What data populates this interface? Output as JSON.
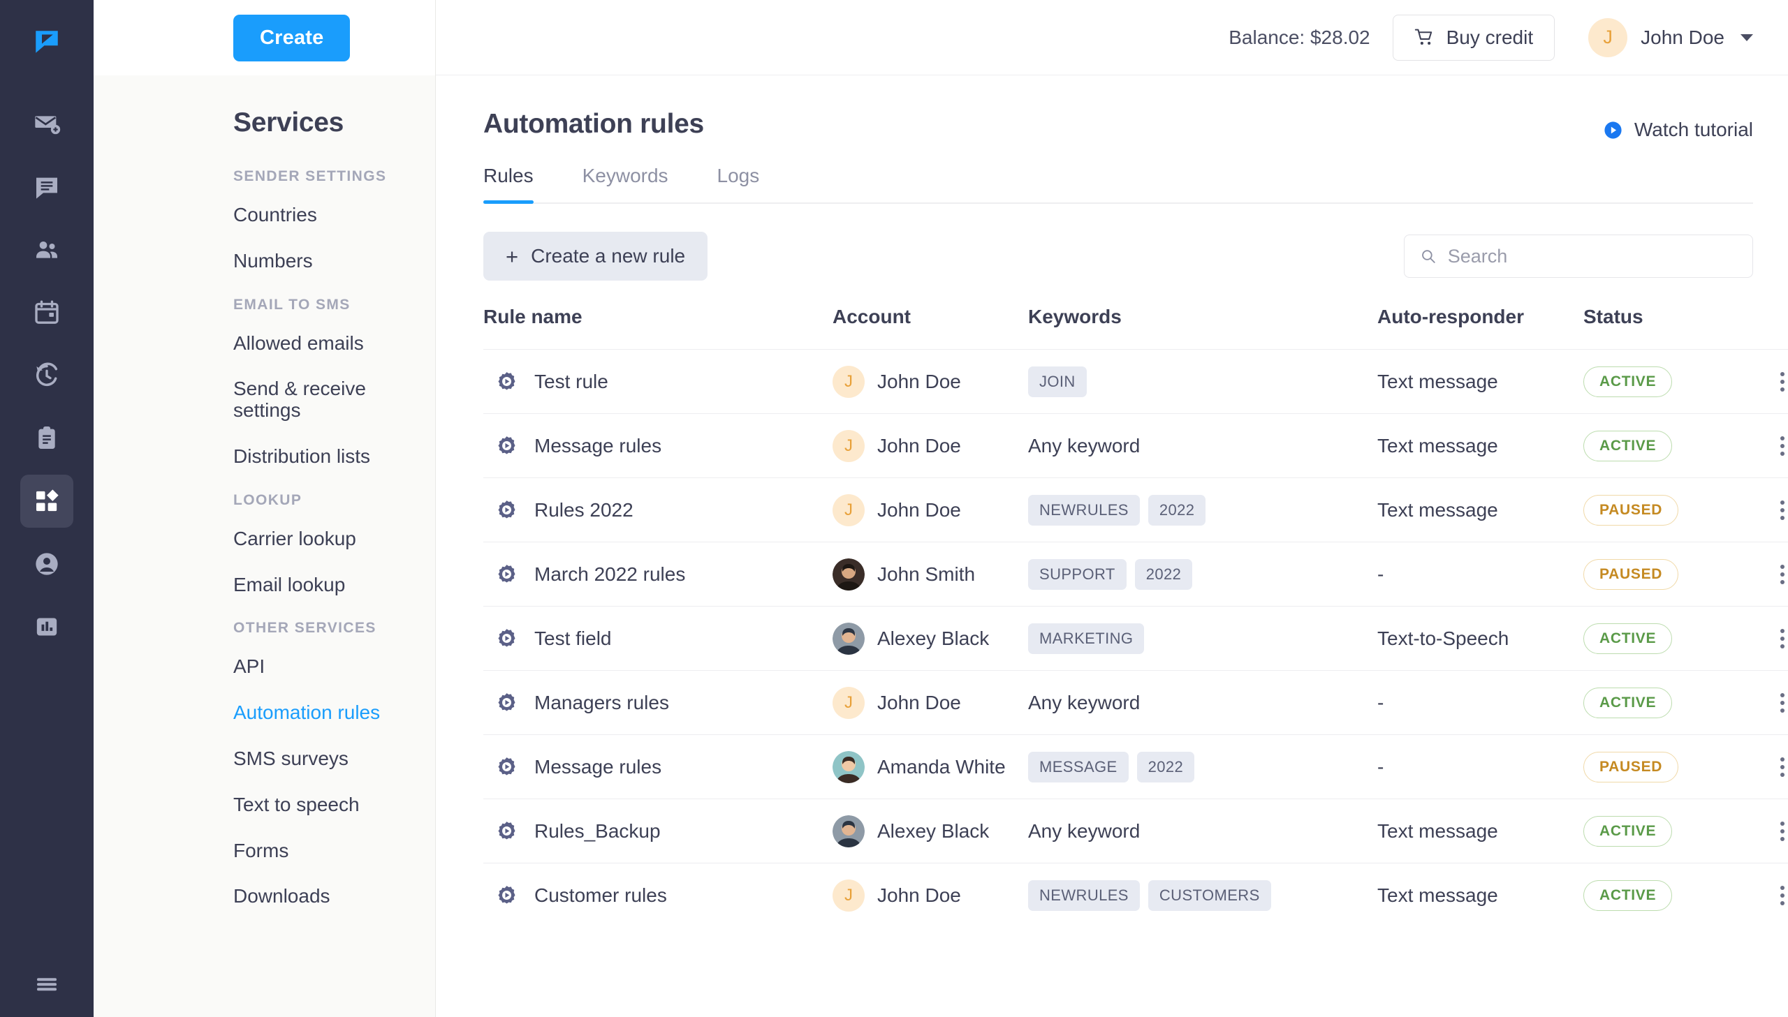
{
  "rail": {
    "items": [
      {
        "icon": "chat-logo-icon",
        "name": "logo",
        "active": false
      },
      {
        "icon": "mail-add-icon",
        "name": "compose",
        "active": false
      },
      {
        "icon": "chat-bubble-icon",
        "name": "messages",
        "active": false
      },
      {
        "icon": "contacts-icon",
        "name": "contacts",
        "active": false
      },
      {
        "icon": "calendar-icon",
        "name": "calendar",
        "active": false
      },
      {
        "icon": "history-icon",
        "name": "history",
        "active": false
      },
      {
        "icon": "clipboard-icon",
        "name": "templates",
        "active": false
      },
      {
        "icon": "apps-grid-icon",
        "name": "services",
        "active": true
      },
      {
        "icon": "account-circle-icon",
        "name": "account",
        "active": false
      },
      {
        "icon": "bar-chart-icon",
        "name": "statistics",
        "active": false
      }
    ],
    "bottom": {
      "icon": "hamburger-icon",
      "name": "collapse-menu"
    }
  },
  "sidebar": {
    "create_label": "Create",
    "title": "Services",
    "groups": [
      {
        "label": "SENDER SETTINGS",
        "items": [
          {
            "label": "Countries",
            "active": false
          },
          {
            "label": "Numbers",
            "active": false
          }
        ]
      },
      {
        "label": "EMAIL TO SMS",
        "items": [
          {
            "label": "Allowed emails",
            "active": false
          },
          {
            "label": "Send & receive settings",
            "active": false
          },
          {
            "label": "Distribution lists",
            "active": false
          }
        ]
      },
      {
        "label": "LOOKUP",
        "items": [
          {
            "label": "Carrier lookup",
            "active": false
          },
          {
            "label": "Email lookup",
            "active": false
          }
        ]
      },
      {
        "label": "OTHER SERVICES",
        "items": [
          {
            "label": "API",
            "active": false
          },
          {
            "label": "Automation rules",
            "active": true
          },
          {
            "label": "SMS surveys",
            "active": false
          },
          {
            "label": "Text to speech",
            "active": false
          },
          {
            "label": "Forms",
            "active": false
          },
          {
            "label": "Downloads",
            "active": false
          }
        ]
      }
    ]
  },
  "topbar": {
    "balance_label": "Balance: $28.02",
    "buy_credit_label": "Buy credit",
    "user_initial": "J",
    "user_name": "John Doe"
  },
  "page": {
    "title": "Automation rules",
    "watch_tutorial_label": "Watch tutorial"
  },
  "tabs": [
    {
      "label": "Rules",
      "active": true
    },
    {
      "label": "Keywords",
      "active": false
    },
    {
      "label": "Logs",
      "active": false
    }
  ],
  "toolbar": {
    "create_rule_label": "Create a new rule",
    "create_rule_plus": "+",
    "search_placeholder": "Search",
    "search_value": ""
  },
  "table": {
    "columns": [
      "Rule name",
      "Account",
      "Keywords",
      "Auto-responder",
      "Status",
      ""
    ],
    "rows": [
      {
        "rule_name": "Test rule",
        "account": "John Doe",
        "avatar_type": "initial",
        "avatar_initial": "J",
        "keywords": [
          "JOIN"
        ],
        "keywords_text": "",
        "auto_responder": "Text message",
        "status": "ACTIVE"
      },
      {
        "rule_name": "Message rules",
        "account": "John Doe",
        "avatar_type": "initial",
        "avatar_initial": "J",
        "keywords": [],
        "keywords_text": "Any keyword",
        "auto_responder": "Text message",
        "status": "ACTIVE"
      },
      {
        "rule_name": "Rules 2022",
        "account": "John Doe",
        "avatar_type": "initial",
        "avatar_initial": "J",
        "keywords": [
          "NEWRULES",
          "2022"
        ],
        "keywords_text": "",
        "auto_responder": "Text message",
        "status": "PAUSED"
      },
      {
        "rule_name": "March 2022 rules",
        "account": "John Smith",
        "avatar_type": "photo-dark",
        "avatar_initial": "",
        "keywords": [
          "SUPPORT",
          "2022"
        ],
        "keywords_text": "",
        "auto_responder": "-",
        "status": "PAUSED"
      },
      {
        "rule_name": "Test field",
        "account": "Alexey Black",
        "avatar_type": "photo-suit",
        "avatar_initial": "",
        "keywords": [
          "MARKETING"
        ],
        "keywords_text": "",
        "auto_responder": "Text-to-Speech",
        "status": "ACTIVE"
      },
      {
        "rule_name": "Managers rules",
        "account": "John Doe",
        "avatar_type": "initial",
        "avatar_initial": "J",
        "keywords": [],
        "keywords_text": "Any keyword",
        "auto_responder": "-",
        "status": "ACTIVE"
      },
      {
        "rule_name": "Message rules",
        "account": "Amanda White",
        "avatar_type": "photo-woman",
        "avatar_initial": "",
        "keywords": [
          "MESSAGE",
          "2022"
        ],
        "keywords_text": "",
        "auto_responder": "-",
        "status": "PAUSED"
      },
      {
        "rule_name": "Rules_Backup",
        "account": "Alexey Black",
        "avatar_type": "photo-suit",
        "avatar_initial": "",
        "keywords": [],
        "keywords_text": "Any keyword",
        "auto_responder": "Text message",
        "status": "ACTIVE"
      },
      {
        "rule_name": "Customer rules",
        "account": "John Doe",
        "avatar_type": "initial",
        "avatar_initial": "J",
        "keywords": [
          "NEWRULES",
          "CUSTOMERS"
        ],
        "keywords_text": "",
        "auto_responder": "Text message",
        "status": "ACTIVE"
      }
    ]
  },
  "colors": {
    "accent": "#1a9dfc",
    "rail_bg": "#2e3147",
    "sidebar_bg": "#fafaf8",
    "text": "#3d4055",
    "active_badge": "#5a9a48",
    "paused_badge": "#c58a22",
    "chip_bg": "#e7eaf2"
  }
}
